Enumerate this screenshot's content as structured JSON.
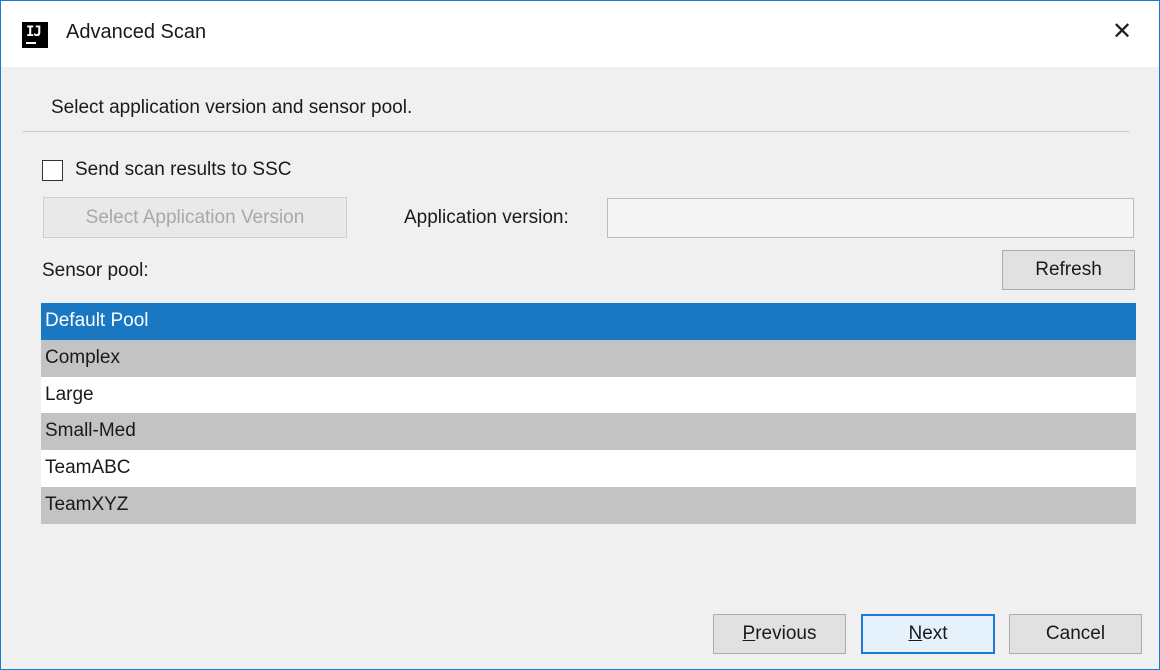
{
  "window": {
    "title": "Advanced Scan",
    "app_icon_text": "IJ",
    "close_glyph": "✕"
  },
  "instruction": "Select application version and sensor pool.",
  "send_results": {
    "label": "Send scan results to SSC",
    "checked": false
  },
  "select_app_version_button": "Select Application Version",
  "app_version": {
    "label": "Application version:",
    "value": ""
  },
  "sensor_pool": {
    "label": "Sensor pool:",
    "refresh_button": "Refresh",
    "items": [
      {
        "label": "Default Pool",
        "state": "selected"
      },
      {
        "label": "Complex",
        "state": "alt"
      },
      {
        "label": "Large",
        "state": "plain"
      },
      {
        "label": "Small-Med",
        "state": "alt"
      },
      {
        "label": "TeamABC",
        "state": "plain"
      },
      {
        "label": "TeamXYZ",
        "state": "alt"
      }
    ]
  },
  "footer": {
    "previous_mnemonic": "P",
    "previous_rest": "revious",
    "next_mnemonic": "N",
    "next_rest": "ext",
    "cancel": "Cancel"
  },
  "colors": {
    "accent": "#1a7ad4",
    "selection": "#1a78c2",
    "alt_row": "#c3c3c3",
    "dialog_bg": "#f0f0f0"
  }
}
